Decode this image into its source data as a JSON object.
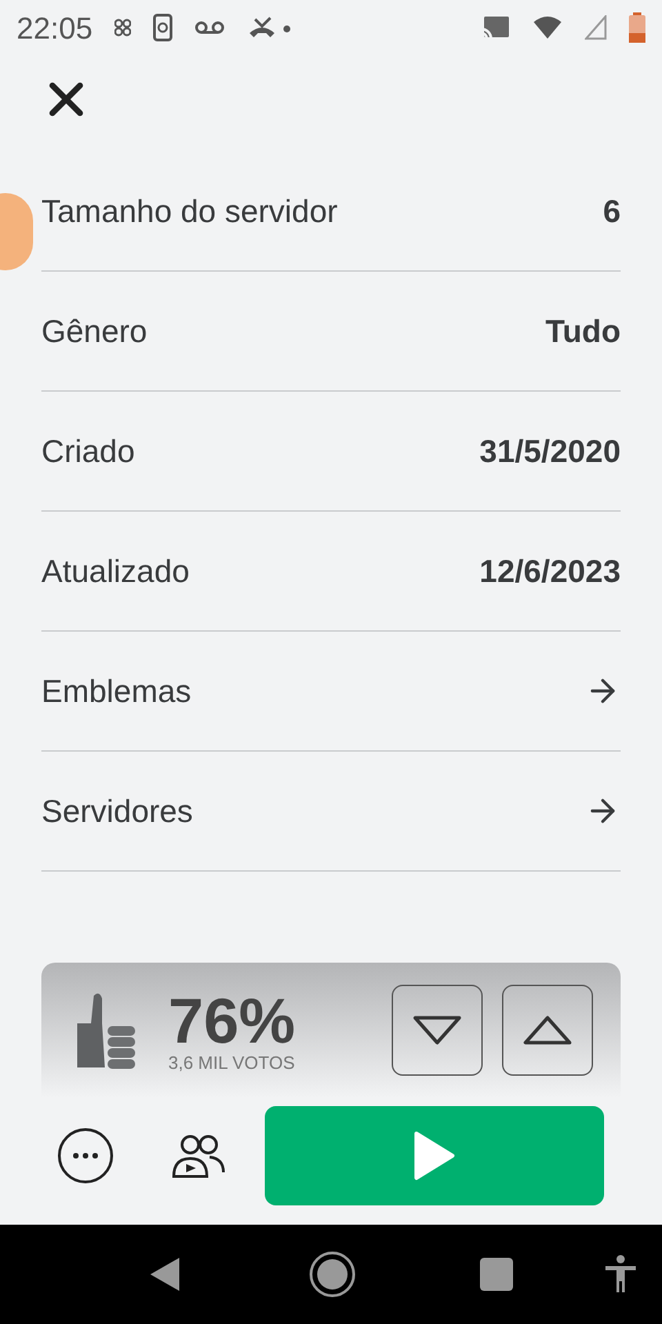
{
  "status_bar": {
    "time": "22:05"
  },
  "rows": [
    {
      "kind": "value",
      "label": "Tamanho do servidor",
      "value": "6"
    },
    {
      "kind": "value",
      "label": "Gênero",
      "value": "Tudo"
    },
    {
      "kind": "value",
      "label": "Criado",
      "value": "31/5/2020"
    },
    {
      "kind": "value",
      "label": "Atualizado",
      "value": "12/6/2023"
    },
    {
      "kind": "link",
      "label": "Emblemas"
    },
    {
      "kind": "link",
      "label": "Servidores"
    }
  ],
  "vote_panel": {
    "percent": "76%",
    "votes": "3,6 MIL VOTOS"
  }
}
